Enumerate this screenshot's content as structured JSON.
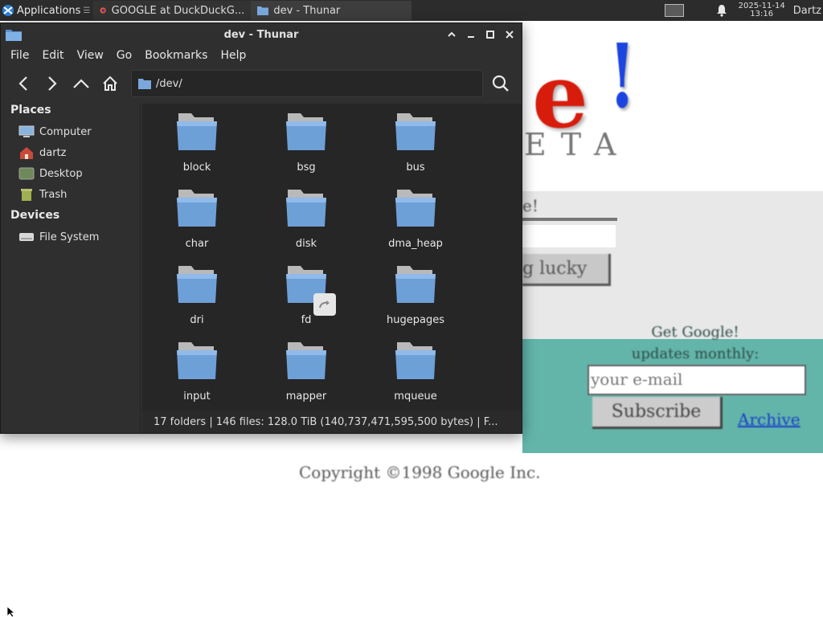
{
  "panel": {
    "applications_label": "Applications",
    "tasks": [
      {
        "label": "GOOGLE at DuckDuckG...",
        "icon": "firefox-icon"
      },
      {
        "label": "dev - Thunar",
        "icon": "folder-icon"
      }
    ],
    "clock_date": "2025-11-14",
    "clock_time": "13:16",
    "user": "Dartz"
  },
  "background_page": {
    "logo_letter": "e",
    "logo_mark": "!",
    "logo_sub": "ETA",
    "search_label": "e!",
    "lucky_button": "g lucky",
    "updates_line1": "Get Google!",
    "updates_line2": "updates monthly:",
    "email_placeholder": "your e-mail",
    "subscribe_button": "Subscribe",
    "archive_link": "Archive",
    "copyright": "Copyright ©1998 Google Inc."
  },
  "window": {
    "title": "dev - Thunar",
    "menu": [
      "File",
      "Edit",
      "View",
      "Go",
      "Bookmarks",
      "Help"
    ],
    "location": "/dev/",
    "sidebar": {
      "places_heading": "Places",
      "places": [
        "Computer",
        "dartz",
        "Desktop",
        "Trash"
      ],
      "devices_heading": "Devices",
      "devices": [
        "File System"
      ]
    },
    "folders": [
      "block",
      "bsg",
      "bus",
      "char",
      "disk",
      "dma_heap",
      "dri",
      "fd",
      "hugepages",
      "input",
      "mapper",
      "mqueue"
    ],
    "status": "17 folders  |  146 files: 128.0 TiB (140,737,471,595,500 bytes)  |  F..."
  },
  "colors": {
    "window_bg": "#2f2f2f",
    "content_bg": "#262626",
    "folder_blue": "#6ea0d8",
    "teal": "#63b5aa",
    "logo_red": "#d81c0c",
    "logo_blue": "#1b44e0"
  }
}
